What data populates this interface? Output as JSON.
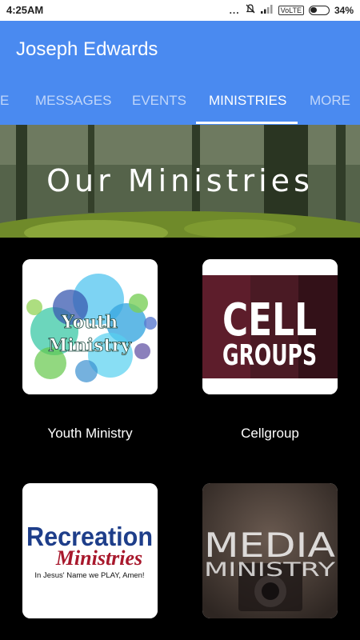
{
  "status": {
    "time": "4:25AM",
    "dots": "...",
    "network": "VoLTE",
    "battery": "34%"
  },
  "app": {
    "title": "Joseph Edwards"
  },
  "tabs": [
    {
      "label": "HOME",
      "visible_text": "E"
    },
    {
      "label": "MESSAGES"
    },
    {
      "label": "EVENTS"
    },
    {
      "label": "MINISTRIES",
      "active": true
    },
    {
      "label": "MORE"
    }
  ],
  "banner": {
    "heading": "Our Ministries"
  },
  "ministries": [
    {
      "name": "Youth Ministry",
      "image_text_1": "Youth",
      "image_text_2": "Ministry"
    },
    {
      "name": "Cellgroup",
      "image_text_1": "CELL",
      "image_text_2": "GROUPS"
    },
    {
      "name": "Recreation",
      "image_text_1": "Recreation",
      "image_text_2": "Ministries",
      "image_text_3": "In Jesus' Name we PLAY, Amen!"
    },
    {
      "name": "Media",
      "image_text_1": "MEDIA",
      "image_text_2": "MINISTRY"
    }
  ],
  "colors": {
    "appbar": "#4a8af0",
    "background": "#000000"
  }
}
